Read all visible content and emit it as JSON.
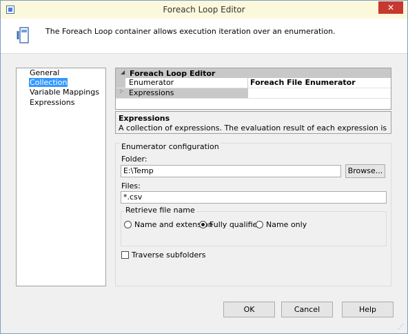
{
  "window": {
    "title": "Foreach Loop Editor",
    "close_label": "✕"
  },
  "header": {
    "text": "The Foreach Loop container allows execution iteration over an enumeration."
  },
  "nav": {
    "items": [
      "General",
      "Collection",
      "Variable Mappings",
      "Expressions"
    ],
    "selected": "Collection"
  },
  "grid": {
    "section": "Foreach Loop Editor",
    "rows": [
      {
        "name": "Enumerator",
        "value": "Foreach File Enumerator"
      },
      {
        "name": "Expressions",
        "value": ""
      }
    ]
  },
  "description": {
    "title": "Expressions",
    "text": "A collection of expressions. The evaluation result of each expression is assigned to a property ..."
  },
  "config": {
    "legend": "Enumerator configuration",
    "folder_label": "Folder:",
    "folder_value": "E:\\Temp",
    "browse_label": "Browse...",
    "files_label": "Files:",
    "files_value": "*.csv",
    "retrieve_legend": "Retrieve file name",
    "options": [
      "Name and extension",
      "Fully qualified",
      "Name only"
    ],
    "selected_option": "Fully qualified",
    "traverse_label": "Traverse subfolders",
    "traverse_checked": false
  },
  "buttons": {
    "ok": "OK",
    "cancel": "Cancel",
    "help": "Help"
  },
  "colors": {
    "selection": "#3399ff",
    "close": "#c7392e"
  }
}
